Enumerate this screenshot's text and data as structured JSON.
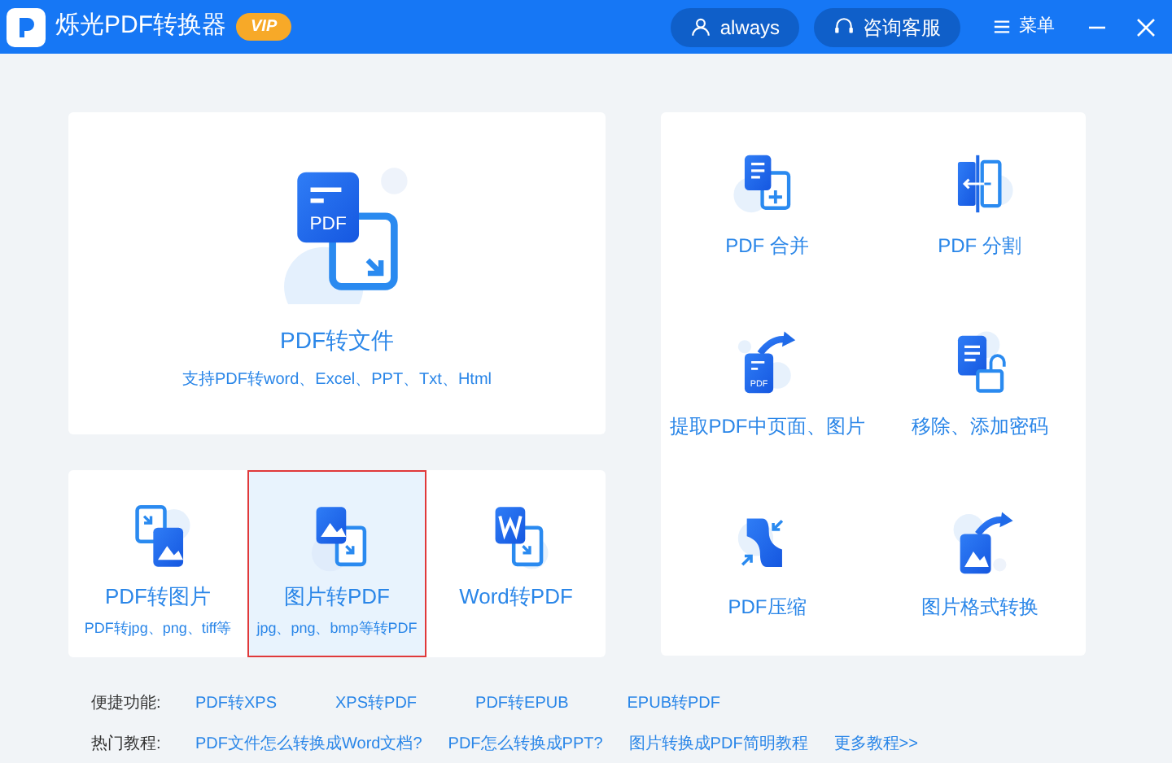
{
  "window": {
    "title": "烁光PDF转换器",
    "badge": "VIP",
    "user": "always",
    "support": "咨询客服",
    "menu": "菜单"
  },
  "main_tool": {
    "kind": "convert",
    "icon_text": "PDF",
    "title": "PDF转文件",
    "subtitle": "支持PDF转word、Excel、PPT、Txt、Html"
  },
  "small_tools": [
    {
      "kind": "toimage",
      "title": "PDF转图片",
      "subtitle": "PDF转jpg、png、tiff等",
      "selected": false
    },
    {
      "kind": "fromimage",
      "title": "图片转PDF",
      "subtitle": "jpg、png、bmp等转PDF",
      "selected": true
    },
    {
      "kind": "word",
      "title": "Word转PDF",
      "selected": false
    }
  ],
  "side_tools": [
    {
      "kind": "merge",
      "title": "PDF 合并"
    },
    {
      "kind": "split",
      "title": "PDF 分割"
    },
    {
      "kind": "extract",
      "icon_text": "PDF",
      "title": "提取PDF中页面、图片"
    },
    {
      "kind": "password",
      "title": "移除、添加密码"
    },
    {
      "kind": "compress",
      "title": "PDF压缩"
    },
    {
      "kind": "imageconvert",
      "title": "图片格式转换"
    }
  ],
  "quick_links": {
    "label": "便捷功能:",
    "links": [
      "PDF转XPS",
      "XPS转PDF",
      "PDF转EPUB",
      "EPUB转PDF"
    ]
  },
  "tutorials": {
    "label": "热门教程:",
    "links": [
      "PDF文件怎么转换成Word文档?",
      "PDF怎么转换成PPT?",
      "图片转换成PDF简明教程",
      "更多教程>>"
    ]
  }
}
